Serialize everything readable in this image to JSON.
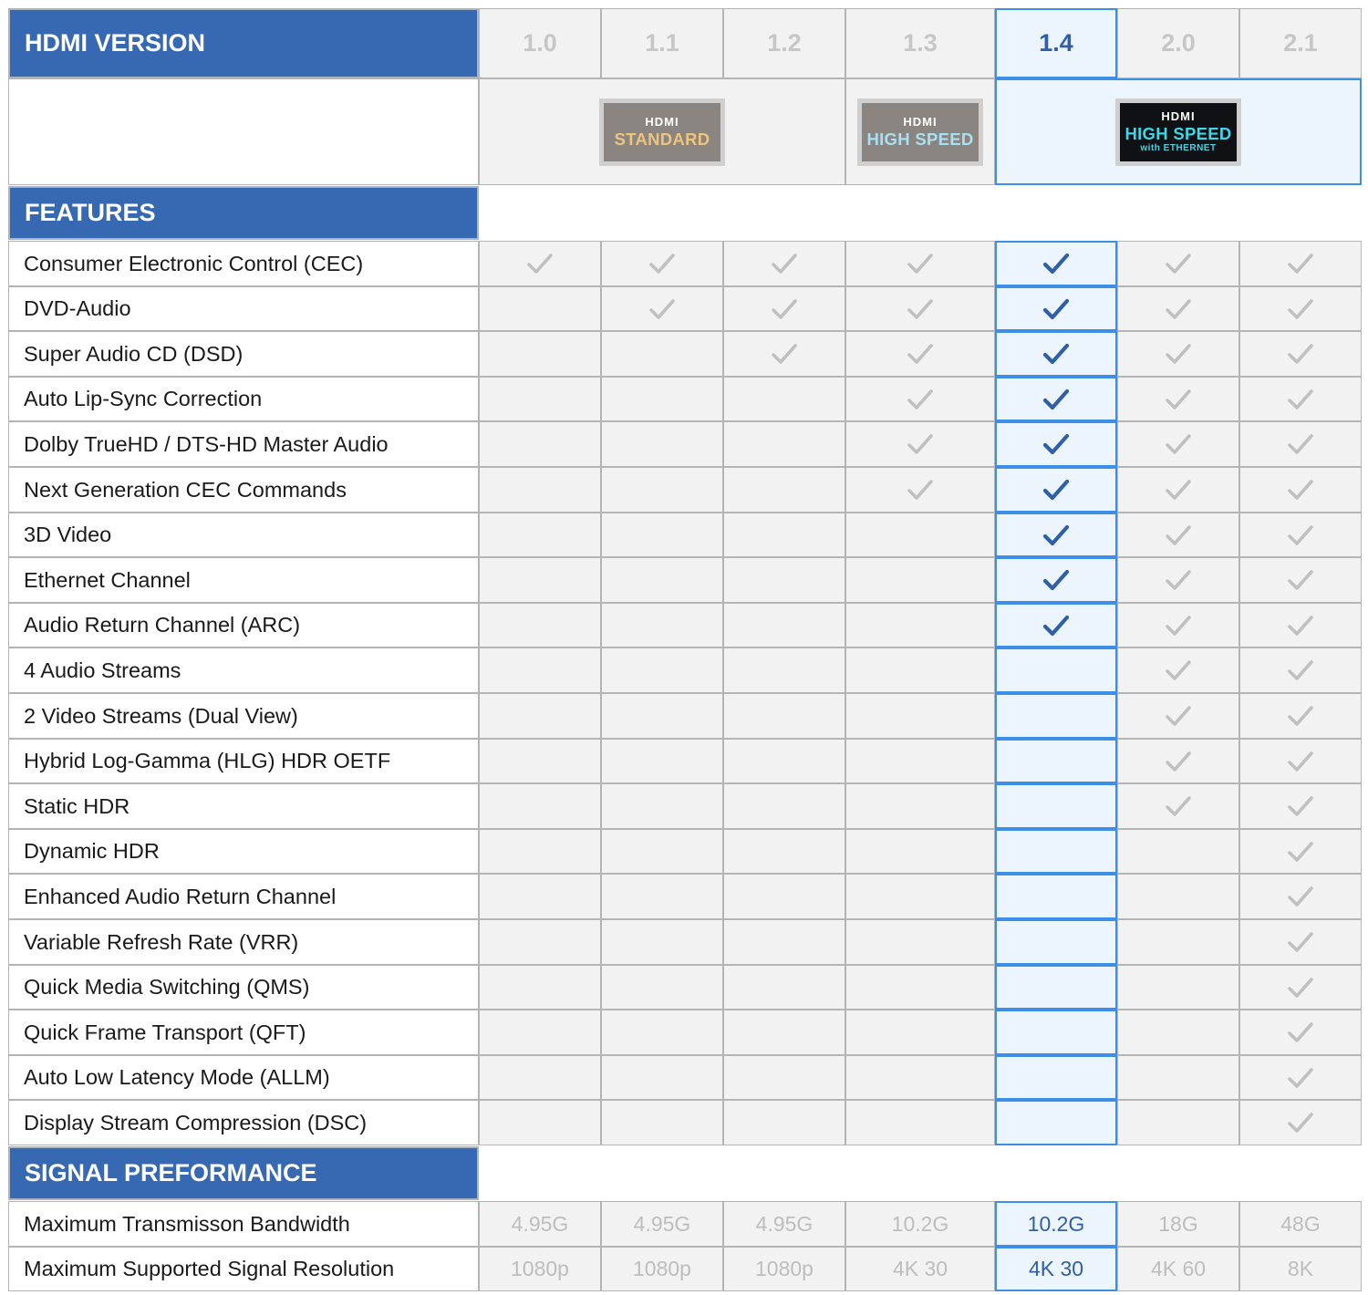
{
  "header": {
    "title": "HDMI VERSION"
  },
  "versions": [
    "1.0",
    "1.1",
    "1.2",
    "1.3",
    "1.4",
    "2.0",
    "2.1"
  ],
  "highlight_version": "1.4",
  "logos": [
    {
      "brand": "HDMI",
      "line1": "STANDARD",
      "line2": "",
      "bg": "#8a8580",
      "color": "#ecc47e"
    },
    {
      "brand": "HDMI",
      "line1": "HIGH SPEED",
      "line2": "",
      "bg": "#8a8580",
      "color": "#a9dff2"
    },
    {
      "brand": "HDMI",
      "line1": "HIGH SPEED",
      "line2": "with ETHERNET",
      "bg": "#0f1114",
      "color": "#3dd8e8"
    }
  ],
  "sections": {
    "features_label": "FEATURES",
    "signal_label": "SIGNAL PREFORMANCE"
  },
  "features": [
    {
      "name": "Consumer Electronic Control (CEC)",
      "support": [
        1,
        1,
        1,
        1,
        1,
        1,
        1
      ]
    },
    {
      "name": "DVD-Audio",
      "support": [
        0,
        1,
        1,
        1,
        1,
        1,
        1
      ]
    },
    {
      "name": "Super Audio CD (DSD)",
      "support": [
        0,
        0,
        1,
        1,
        1,
        1,
        1
      ]
    },
    {
      "name": "Auto Lip-Sync Correction",
      "support": [
        0,
        0,
        0,
        1,
        1,
        1,
        1
      ]
    },
    {
      "name": "Dolby TrueHD / DTS-HD Master Audio",
      "support": [
        0,
        0,
        0,
        1,
        1,
        1,
        1
      ]
    },
    {
      "name": "Next Generation CEC Commands",
      "support": [
        0,
        0,
        0,
        1,
        1,
        1,
        1
      ]
    },
    {
      "name": "3D Video",
      "support": [
        0,
        0,
        0,
        0,
        1,
        1,
        1
      ]
    },
    {
      "name": "Ethernet Channel",
      "support": [
        0,
        0,
        0,
        0,
        1,
        1,
        1
      ]
    },
    {
      "name": "Audio Return Channel (ARC)",
      "support": [
        0,
        0,
        0,
        0,
        1,
        1,
        1
      ]
    },
    {
      "name": "4 Audio Streams",
      "support": [
        0,
        0,
        0,
        0,
        0,
        1,
        1
      ]
    },
    {
      "name": "2 Video Streams (Dual View)",
      "support": [
        0,
        0,
        0,
        0,
        0,
        1,
        1
      ]
    },
    {
      "name": "Hybrid Log-Gamma (HLG) HDR OETF",
      "support": [
        0,
        0,
        0,
        0,
        0,
        1,
        1
      ]
    },
    {
      "name": "Static HDR",
      "support": [
        0,
        0,
        0,
        0,
        0,
        1,
        1
      ]
    },
    {
      "name": "Dynamic HDR",
      "support": [
        0,
        0,
        0,
        0,
        0,
        0,
        1
      ]
    },
    {
      "name": "Enhanced Audio Return Channel",
      "support": [
        0,
        0,
        0,
        0,
        0,
        0,
        1
      ]
    },
    {
      "name": "Variable Refresh Rate (VRR)",
      "support": [
        0,
        0,
        0,
        0,
        0,
        0,
        1
      ]
    },
    {
      "name": "Quick Media Switching (QMS)",
      "support": [
        0,
        0,
        0,
        0,
        0,
        0,
        1
      ]
    },
    {
      "name": "Quick Frame Transport (QFT)",
      "support": [
        0,
        0,
        0,
        0,
        0,
        0,
        1
      ]
    },
    {
      "name": "Auto Low Latency Mode (ALLM)",
      "support": [
        0,
        0,
        0,
        0,
        0,
        0,
        1
      ]
    },
    {
      "name": "Display Stream Compression (DSC)",
      "support": [
        0,
        0,
        0,
        0,
        0,
        0,
        1
      ]
    }
  ],
  "signal": [
    {
      "name": "Maximum Transmisson Bandwidth",
      "values": [
        "4.95G",
        "4.95G",
        "4.95G",
        "10.2G",
        "10.2G",
        "18G",
        "48G"
      ]
    },
    {
      "name": "Maximum Supported Signal Resolution",
      "values": [
        "1080p",
        "1080p",
        "1080p",
        "4K 30",
        "4K 30",
        "4K 60",
        "8K"
      ]
    }
  ],
  "colors": {
    "header_blue": "#3669b1",
    "highlight_border": "#3d8ee6",
    "highlight_fill": "#ecf4fd",
    "check_gray": "#c0c0c0",
    "check_blue": "#2f5fa6"
  }
}
